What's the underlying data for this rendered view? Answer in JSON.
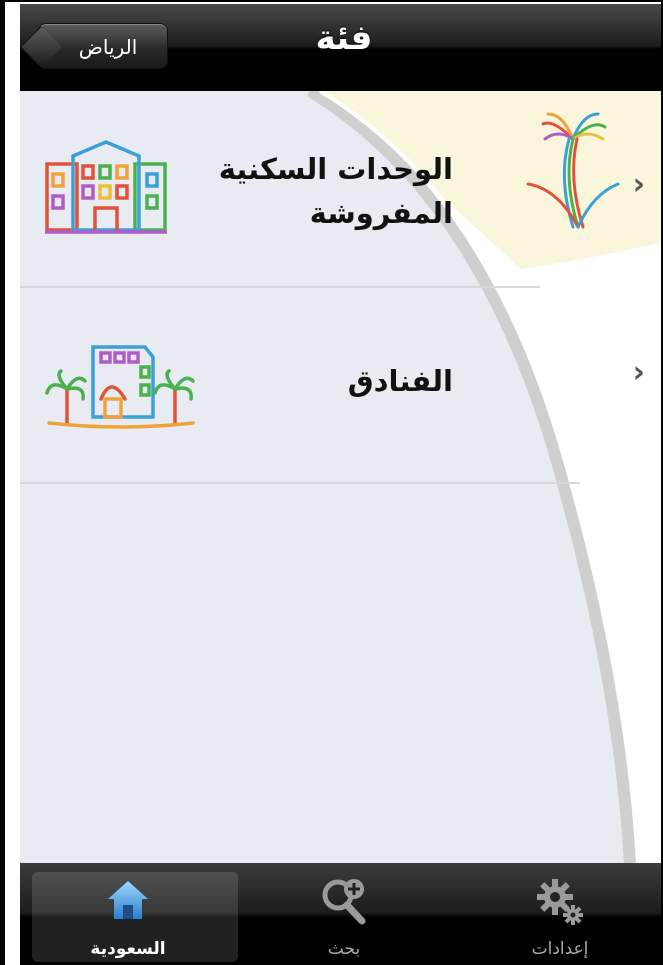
{
  "navbar": {
    "title": "فئة",
    "back_label": "الرياض"
  },
  "rows": [
    {
      "line1": "الوحدات السكنية",
      "line2": "المفروشة",
      "chevron": "›",
      "icon": "apartment-building-icon"
    },
    {
      "line1": "الفنادق",
      "chevron": "›",
      "icon": "hotel-palms-icon"
    }
  ],
  "logo": "palm-tree-logo-icon",
  "tabs": [
    {
      "label": "السعودية",
      "icon": "home-icon",
      "active": true
    },
    {
      "label": "بحث",
      "icon": "search-plus-icon",
      "active": false
    },
    {
      "label": "إعدادات",
      "icon": "gears-icon",
      "active": false
    }
  ],
  "colors": {
    "nav_bg": "#000000",
    "content_bg": "#e8ecf2",
    "logo_bg": "#faf6dc",
    "curve": "#cfcfcf"
  }
}
